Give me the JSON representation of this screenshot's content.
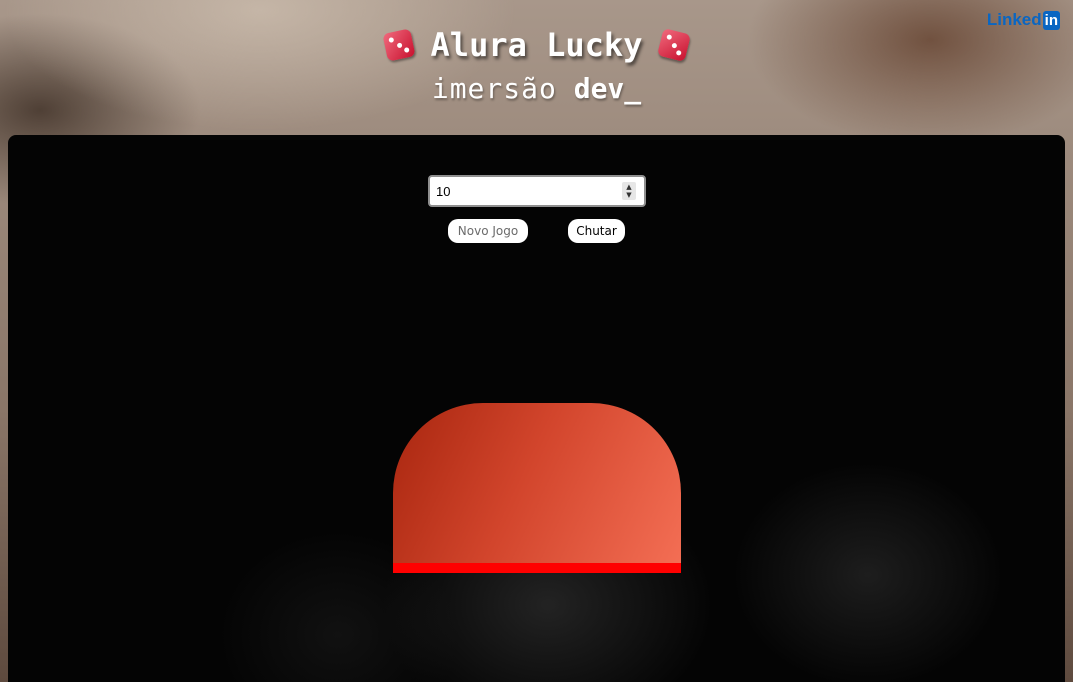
{
  "header": {
    "title": "Alura Lucky",
    "title_icon_left": "red-die-icon",
    "title_icon_right": "red-die-icon",
    "subtitle_light": "imersão",
    "subtitle_bold": "dev_",
    "linkedin_text": "Linked",
    "linkedin_badge": "in"
  },
  "game": {
    "guess_input_value": "10",
    "new_game_label": "Novo Jogo",
    "guess_label": "Chutar"
  },
  "colors": {
    "linkedin_blue": "#0a66c2",
    "dome_gradient_start": "#a8260f",
    "dome_gradient_end": "#f46f55",
    "dome_bar": "#ff0000",
    "die_red": "#c8102e"
  }
}
